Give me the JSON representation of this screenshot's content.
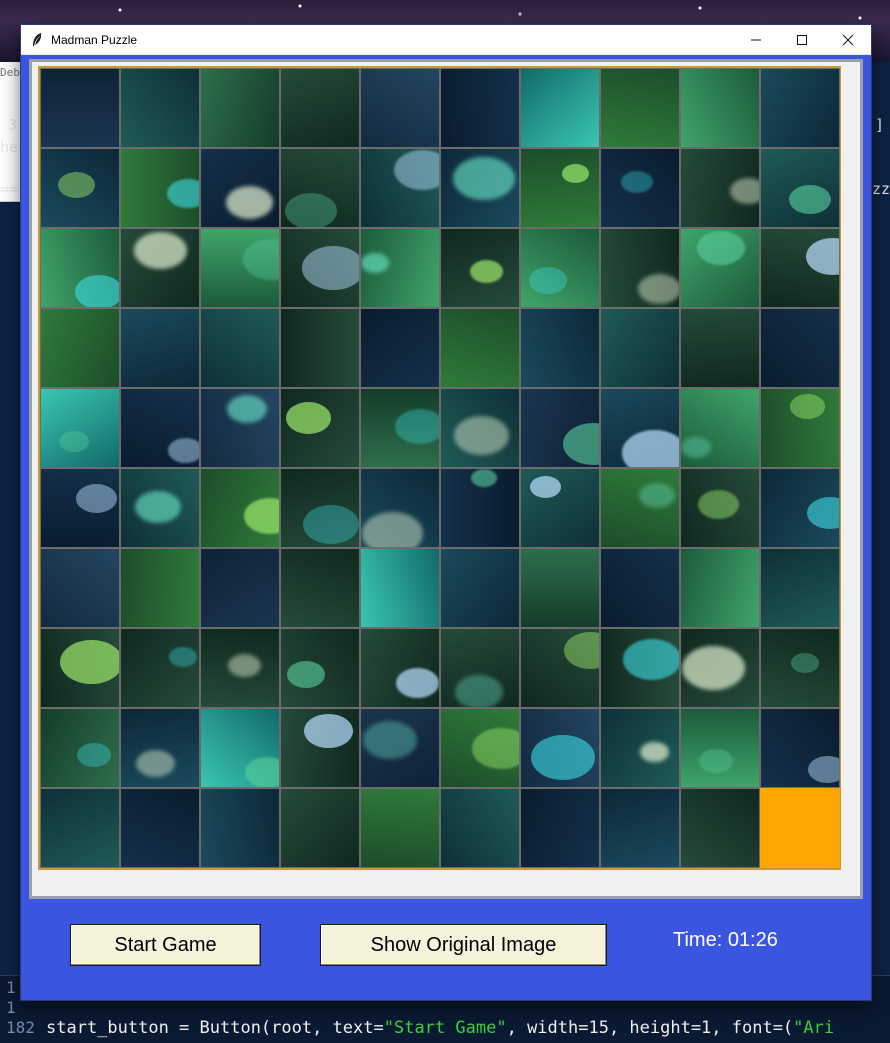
{
  "window": {
    "title": "Madman Puzzle",
    "icon": "feather-icon",
    "controls": {
      "minimize": "—",
      "maximize": "☐",
      "close": "✕"
    }
  },
  "background_editor": {
    "frag_1": "3",
    "frag_2": "he",
    "frag_3": "==",
    "frag_4": "Debu",
    "frag_5": "]",
    "frag_6": "zzl",
    "line_numbers": [
      "1",
      "1",
      "182"
    ],
    "code_prefix": "start_button = Button(root, text=",
    "code_string": "\"Start Game\"",
    "code_suffix": ", width=15, height=1, font=(",
    "code_tail": "\"Ari"
  },
  "puzzle": {
    "rows": 10,
    "cols": 10,
    "blank_position": {
      "row": 9,
      "col": 9
    },
    "blank_color": "#FFA500"
  },
  "controls": {
    "start_label": "Start Game",
    "show_label": "Show Original Image",
    "timer_text": "Time: 01:26"
  },
  "colors": {
    "window_bg": "#3A56E0",
    "button_bg": "#F5F2DC",
    "board_border": "#C79A36"
  }
}
